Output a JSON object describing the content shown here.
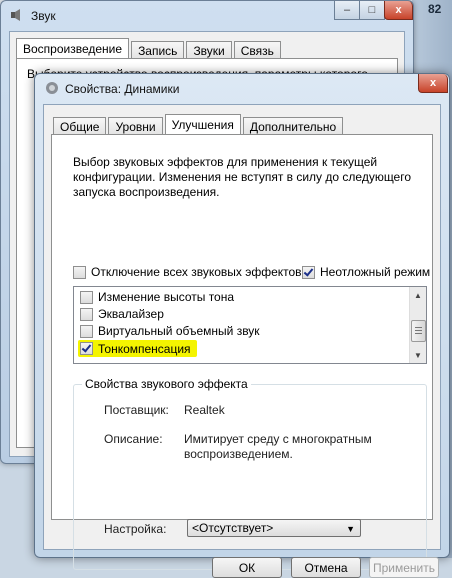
{
  "desktop": {
    "percent_text": "82"
  },
  "back_window": {
    "title": "Звук",
    "tabs": [
      "Воспроизведение",
      "Запись",
      "Звуки",
      "Связь"
    ],
    "active_tab": 0,
    "panel_text": "Выберите устройство воспроизведения, параметры которого"
  },
  "front_window": {
    "title": "Свойства: Динамики",
    "tabs": [
      "Общие",
      "Уровни",
      "Улучшения",
      "Дополнительно"
    ],
    "active_tab": 2,
    "description": "Выбор звуковых эффектов для применения к текущей конфигурации. Изменения не вступят в силу до следующего запуска воспроизведения.",
    "options": {
      "disable_all_label": "Отключение всех звуковых эффектов",
      "disable_all_checked": false,
      "immediate_label": "Неотложный режим",
      "immediate_checked": true
    },
    "effects": [
      {
        "label": "Изменение высоты тона",
        "checked": false,
        "highlighted": false
      },
      {
        "label": "Эквалайзер",
        "checked": false,
        "highlighted": false
      },
      {
        "label": "Виртуальный объемный звук",
        "checked": false,
        "highlighted": false
      },
      {
        "label": "Тонкомпенсация",
        "checked": true,
        "highlighted": true
      }
    ],
    "effect_props": {
      "group_label": "Свойства звукового эффекта",
      "provider_label": "Поставщик:",
      "provider_value": "Realtek",
      "description_label": "Описание:",
      "description_value_line1": "Имитирует среду с многократным",
      "description_value_line2": "воспроизведением.",
      "settings_label": "Настройка:",
      "settings_value": "<Отсутствует>"
    },
    "buttons": {
      "ok": "ОК",
      "cancel": "Отмена",
      "apply": "Применить"
    },
    "highlight_color": "#f4f400"
  },
  "window_controls": {
    "minimize": "–",
    "maximize": "□",
    "close": "x"
  }
}
